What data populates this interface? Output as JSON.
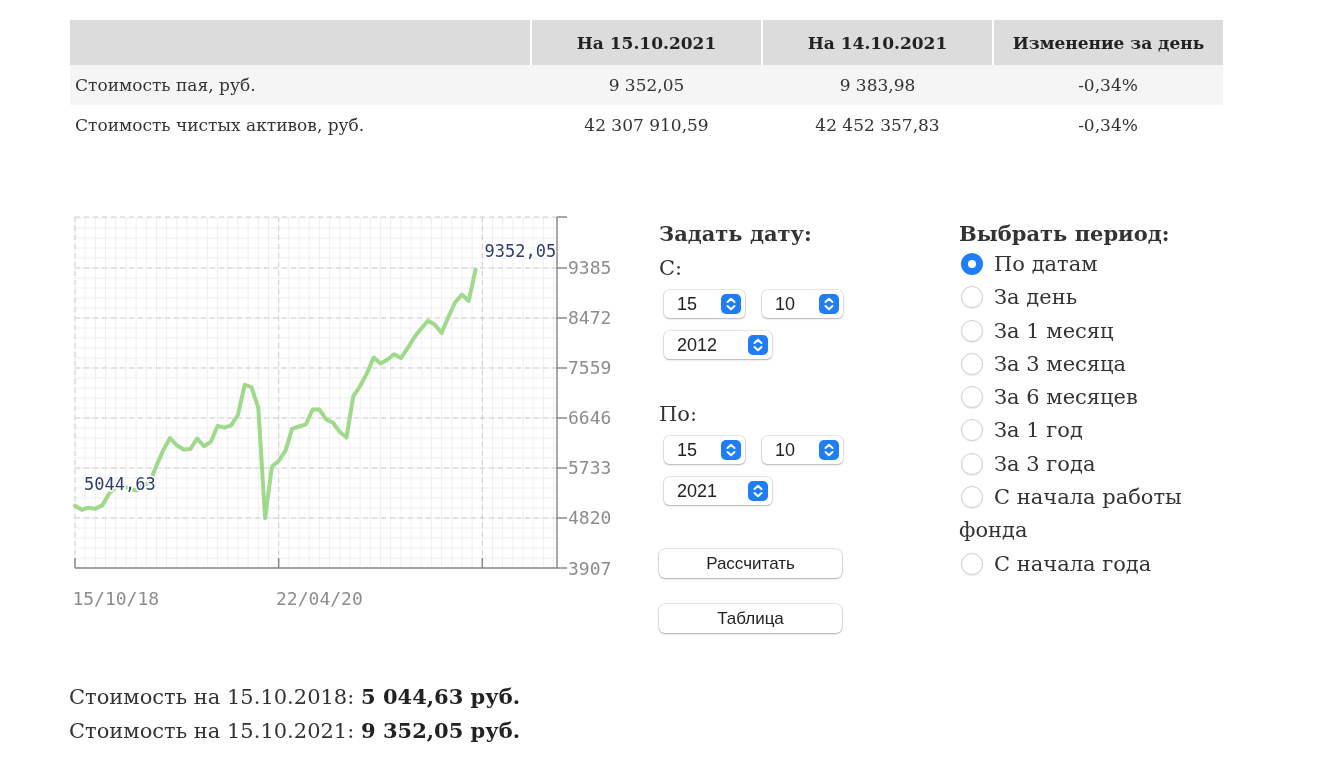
{
  "table": {
    "columns": [
      "На 15.10.2021",
      "На 14.10.2021",
      "Изменение за день"
    ],
    "rows": [
      {
        "label": "Стоимость пая, руб.",
        "cells": [
          "9 352,05",
          "9 383,98",
          "-0,34%"
        ]
      },
      {
        "label": "Стоимость чистых активов, руб.",
        "cells": [
          "42 307 910,59",
          "42 452 357,83",
          "-0,34%"
        ]
      }
    ]
  },
  "chart": {
    "chart_data": {
      "type": "line",
      "grid": true,
      "categories": [
        null,
        null,
        null,
        null,
        null,
        null,
        "15/10/18",
        null,
        null,
        null,
        null,
        null,
        null,
        null,
        null,
        null,
        null,
        null,
        null,
        null,
        null,
        null,
        null,
        null,
        null,
        null,
        null,
        null,
        null,
        null,
        null,
        null,
        null,
        null,
        null,
        null,
        "22/04/20",
        null,
        null,
        null,
        null,
        null,
        null,
        null,
        null,
        null,
        null,
        null,
        null,
        null,
        null,
        null,
        null,
        null,
        null,
        null,
        null,
        null,
        null,
        null,
        null,
        null,
        null,
        null,
        null,
        null,
        null,
        null,
        null,
        null,
        null,
        null
      ],
      "series": [
        {
          "color": "#a0d98c",
          "values": [
            5044.63,
            4970,
            5010,
            4990,
            5050,
            5260,
            5380,
            5400,
            5360,
            5320,
            5420,
            5460,
            5780,
            6060,
            6280,
            6150,
            6070,
            6080,
            6270,
            6130,
            6210,
            6500,
            6470,
            6510,
            6700,
            7250,
            7210,
            6830,
            4820,
            5760,
            5860,
            6050,
            6450,
            6490,
            6530,
            6800,
            6800,
            6620,
            6560,
            6390,
            6290,
            7040,
            7230,
            7460,
            7750,
            7640,
            7710,
            7810,
            7740,
            7920,
            8120,
            8280,
            8420,
            8350,
            8200,
            8490,
            8760,
            8900,
            8780,
            9352.05,
            null,
            null,
            null,
            null,
            null,
            null,
            null,
            null,
            null,
            null,
            null,
            null
          ]
        }
      ],
      "ylim": [
        3907,
        10316
      ],
      "yticks": [
        3907,
        4820,
        5733,
        6646,
        7559,
        8472,
        9385
      ],
      "annotations": [
        "5044,63",
        "9352,05"
      ]
    }
  },
  "date_form": {
    "title": "Задать дату:",
    "ranges": [
      {
        "label": "С:",
        "day": "15",
        "month": "10",
        "year": "2012"
      },
      {
        "label": "По:",
        "day": "15",
        "month": "10",
        "year": "2021"
      }
    ],
    "buttons": [
      "Рассчитать",
      "Таблица"
    ]
  },
  "period": {
    "title": "Выбрать период:",
    "options": [
      {
        "label": "По датам",
        "selected": true
      },
      {
        "label": "За день",
        "selected": false
      },
      {
        "label": "За 1 месяц",
        "selected": false
      },
      {
        "label": "За 3 месяца",
        "selected": false
      },
      {
        "label": "За 6 месяцев",
        "selected": false
      },
      {
        "label": "За 1 год",
        "selected": false
      },
      {
        "label": "За 3 года",
        "selected": false
      },
      {
        "label": "С начала работы фонда",
        "selected": false
      },
      {
        "label": "С начала года",
        "selected": false
      }
    ]
  },
  "summary": [
    "Стоимость на 15.10.2018: **5 044,63 руб.**",
    "Стоимость на 15.10.2021: **9 352,05 руб.**"
  ]
}
